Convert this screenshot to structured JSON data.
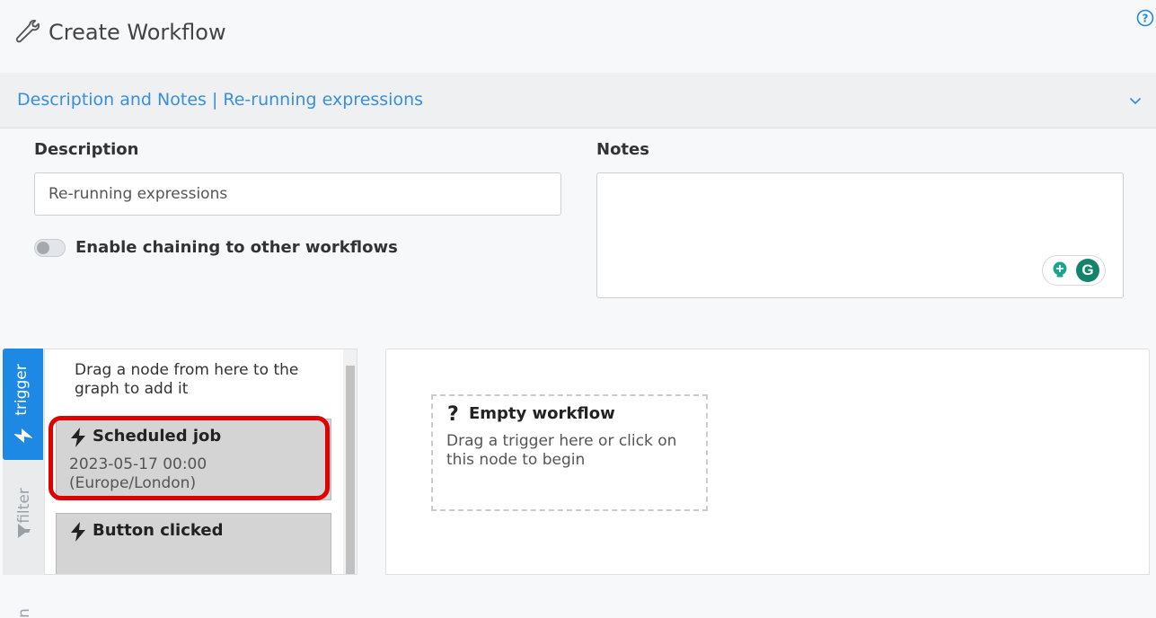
{
  "header": {
    "title": "Create Workflow"
  },
  "accordion": {
    "title": "Description and Notes | Re-running expressions"
  },
  "form": {
    "description_label": "Description",
    "description_value": "Re-running expressions",
    "notes_label": "Notes",
    "notes_value": "",
    "chaining_label": "Enable chaining to other workflows",
    "chaining_enabled": false
  },
  "grammarly": {
    "logo_letter": "G"
  },
  "palette": {
    "tabs": [
      {
        "label": "trigger",
        "active": true
      },
      {
        "label": "filter",
        "active": false
      },
      {
        "label": "n",
        "active": false
      }
    ],
    "hint": "Drag a node from here to the graph to add it",
    "nodes": [
      {
        "title": "Scheduled job",
        "subtitle": "2023-05-17 00:00 (Europe/London)",
        "highlighted": true
      },
      {
        "title": "Button clicked",
        "subtitle": ""
      }
    ]
  },
  "graph": {
    "empty_node": {
      "title": "Empty workflow",
      "description": "Drag a trigger here or click on this node to begin"
    }
  },
  "colors": {
    "accent": "#1e88e5",
    "link": "#3a8fd9",
    "highlight": "#e00000",
    "grammarly": "#13836b"
  },
  "icons": [
    "wrench-icon",
    "help-icon",
    "chevron-down-icon",
    "bolt-icon",
    "filter-icon",
    "question-icon",
    "bulb-icon"
  ]
}
